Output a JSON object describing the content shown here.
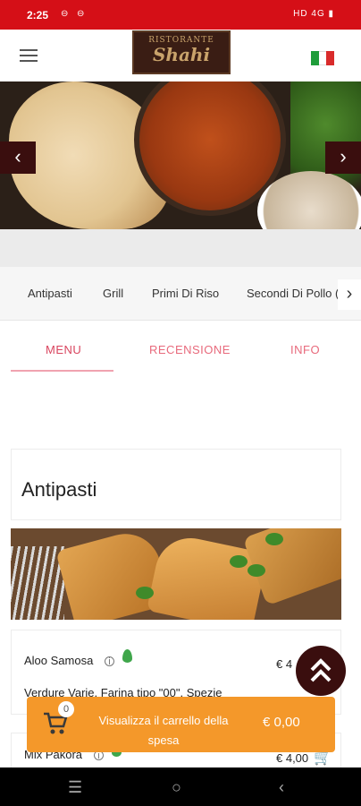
{
  "status": {
    "time": "2:25",
    "icons_left": [
      "sim1-icon",
      "sim2-icon"
    ],
    "indicators": "HD  4G  ▮"
  },
  "header": {
    "logo_line1": "RISTORANTE",
    "logo_line2": "Shahi",
    "language_flag": "italian-flag-icon"
  },
  "hero": {
    "prev_label": "‹",
    "next_label": "›"
  },
  "categories": [
    "Antipasti",
    "Grill",
    "Primi Di Riso",
    "Secondi Di Pollo ("
  ],
  "category_next": "›",
  "tabs": [
    {
      "label": "MENU",
      "active": true
    },
    {
      "label": "RECENSIONE",
      "active": false
    },
    {
      "label": "INFO",
      "active": false
    }
  ],
  "section": {
    "title": "Antipasti"
  },
  "items": [
    {
      "name": "Aloo Samosa",
      "price": "€ 4",
      "description": "Verdure Varie, Farina tipo \"00\", Spezie"
    },
    {
      "name": "Mix Pakora",
      "price": "€ 4,00",
      "description": ""
    }
  ],
  "cart": {
    "count": "0",
    "label": "Visualizza il carrello della spesa",
    "total": "€ 0,00"
  },
  "colors": {
    "status_bar": "#d50f17",
    "accent_pink": "#e86a7c",
    "cart_orange": "#f4982a",
    "dark_brown": "#3a0e0e"
  }
}
